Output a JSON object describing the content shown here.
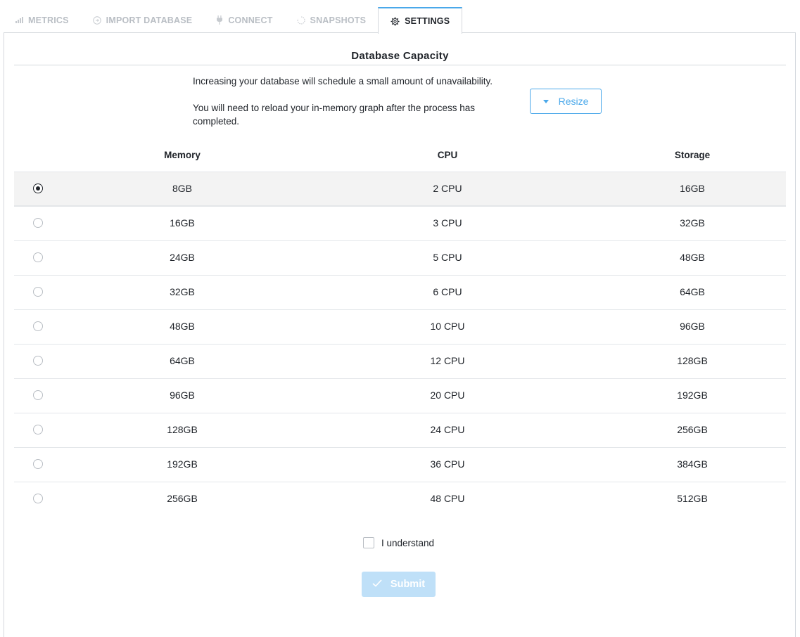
{
  "tabs": [
    {
      "label": "METRICS",
      "icon": "bar-chart-icon",
      "active": false
    },
    {
      "label": "IMPORT DATABASE",
      "icon": "import-icon",
      "active": false
    },
    {
      "label": "CONNECT",
      "icon": "plug-icon",
      "active": false
    },
    {
      "label": "SNAPSHOTS",
      "icon": "snapshot-icon",
      "active": false
    },
    {
      "label": "SETTINGS",
      "icon": "gear-icon",
      "active": true
    }
  ],
  "section": {
    "title": "Database Capacity",
    "notice_line1": "Increasing your database will schedule a small amount of unavailability.",
    "notice_line2": "You will need to reload your in-memory graph after the process has completed.",
    "resize_label": "Resize"
  },
  "table": {
    "headers": {
      "memory": "Memory",
      "cpu": "CPU",
      "storage": "Storage"
    },
    "rows": [
      {
        "memory": "8GB",
        "cpu": "2 CPU",
        "storage": "16GB",
        "selected": true
      },
      {
        "memory": "16GB",
        "cpu": "3 CPU",
        "storage": "32GB",
        "selected": false
      },
      {
        "memory": "24GB",
        "cpu": "5 CPU",
        "storage": "48GB",
        "selected": false
      },
      {
        "memory": "32GB",
        "cpu": "6 CPU",
        "storage": "64GB",
        "selected": false
      },
      {
        "memory": "48GB",
        "cpu": "10 CPU",
        "storage": "96GB",
        "selected": false
      },
      {
        "memory": "64GB",
        "cpu": "12 CPU",
        "storage": "128GB",
        "selected": false
      },
      {
        "memory": "96GB",
        "cpu": "20 CPU",
        "storage": "192GB",
        "selected": false
      },
      {
        "memory": "128GB",
        "cpu": "24 CPU",
        "storage": "256GB",
        "selected": false
      },
      {
        "memory": "192GB",
        "cpu": "36 CPU",
        "storage": "384GB",
        "selected": false
      },
      {
        "memory": "256GB",
        "cpu": "48 CPU",
        "storage": "512GB",
        "selected": false
      }
    ]
  },
  "confirm": {
    "checkbox_label": "I understand",
    "checked": false
  },
  "submit": {
    "label": "Submit",
    "enabled": false
  },
  "colors": {
    "accent": "#4aa8ea",
    "disabled_button": "#bfe0f8",
    "selected_row": "#f3f3f3"
  }
}
